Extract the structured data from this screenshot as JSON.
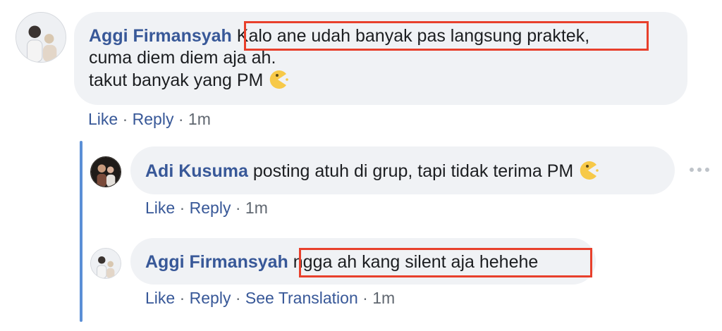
{
  "comments": [
    {
      "author": "Aggi Firmansyah",
      "lines": [
        "Kalo ane udah banyak pas langsung praktek,",
        "cuma diem diem aja ah.",
        "takut banyak yang PM"
      ],
      "emoji": "pacman-emoji",
      "actions": {
        "like": "Like",
        "reply": "Reply",
        "time": "1m"
      }
    },
    {
      "author": "Adi Kusuma",
      "text": "posting atuh di grup, tapi tidak terima PM",
      "emoji": "pacman-emoji",
      "actions": {
        "like": "Like",
        "reply": "Reply",
        "time": "1m"
      }
    },
    {
      "author": "Aggi Firmansyah",
      "text": "ngga ah kang silent aja hehehe",
      "actions": {
        "like": "Like",
        "reply": "Reply",
        "translate": "See Translation",
        "time": "1m"
      }
    }
  ],
  "separator": "·",
  "colors": {
    "author": "#385898",
    "bubble": "#f0f2f5",
    "highlight": "#e8402c",
    "thread_line": "#5b8fd6",
    "emoji": "#f7c948"
  }
}
